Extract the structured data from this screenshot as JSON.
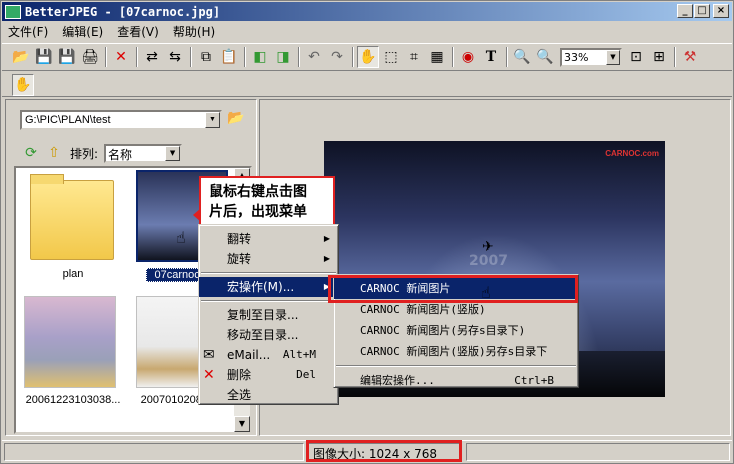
{
  "window": {
    "title": "BetterJPEG - [07carnoc.jpg]",
    "min_label": "_",
    "max_label": "□",
    "close_label": "×"
  },
  "menubar": [
    "文件(F)",
    "编辑(E)",
    "查看(V)",
    "帮助(H)"
  ],
  "toolbar": {
    "zoom_value": "33%"
  },
  "left_panel": {
    "path": "G:\\PIC\\PLAN\\test",
    "sort_label": "排列:",
    "sort_value": "名称",
    "thumbnails": [
      {
        "caption": "plan"
      },
      {
        "caption": "07carnoc.jpg"
      },
      {
        "caption": "20061223103038..."
      },
      {
        "caption": "2007010208174..."
      }
    ]
  },
  "callout": {
    "line1": "鼠标右键点击图",
    "line2": "片后，出现菜单"
  },
  "photo": {
    "logo_text": "CARNOC.com",
    "watermark": "2007"
  },
  "context_menu": {
    "items": [
      {
        "label": "翻转",
        "submenu": true
      },
      {
        "label": "旋转",
        "submenu": true
      },
      {
        "label": "宏操作(M)...",
        "submenu": true,
        "highlighted": true
      },
      {
        "label": "复制至目录..."
      },
      {
        "label": "移动至目录..."
      },
      {
        "label": "eMail...",
        "shortcut": "Alt+M"
      },
      {
        "label": "删除",
        "shortcut": "Del"
      },
      {
        "label": "全选"
      }
    ]
  },
  "submenu": {
    "items": [
      {
        "label": "CARNOC 新闻图片",
        "highlighted": true
      },
      {
        "label": "CARNOC 新闻图片(竖版)"
      },
      {
        "label": "CARNOC 新闻图片(另存s目录下)"
      },
      {
        "label": "CARNOC 新闻图片(竖版)另存s目录下"
      },
      {
        "label": "编辑宏操作...",
        "shortcut": "Ctrl+B"
      }
    ]
  },
  "status": {
    "image_size": "图像大小:  1024 x 768"
  },
  "colors": {
    "highlight": "#0a246a",
    "annotation_red": "#e02020"
  }
}
